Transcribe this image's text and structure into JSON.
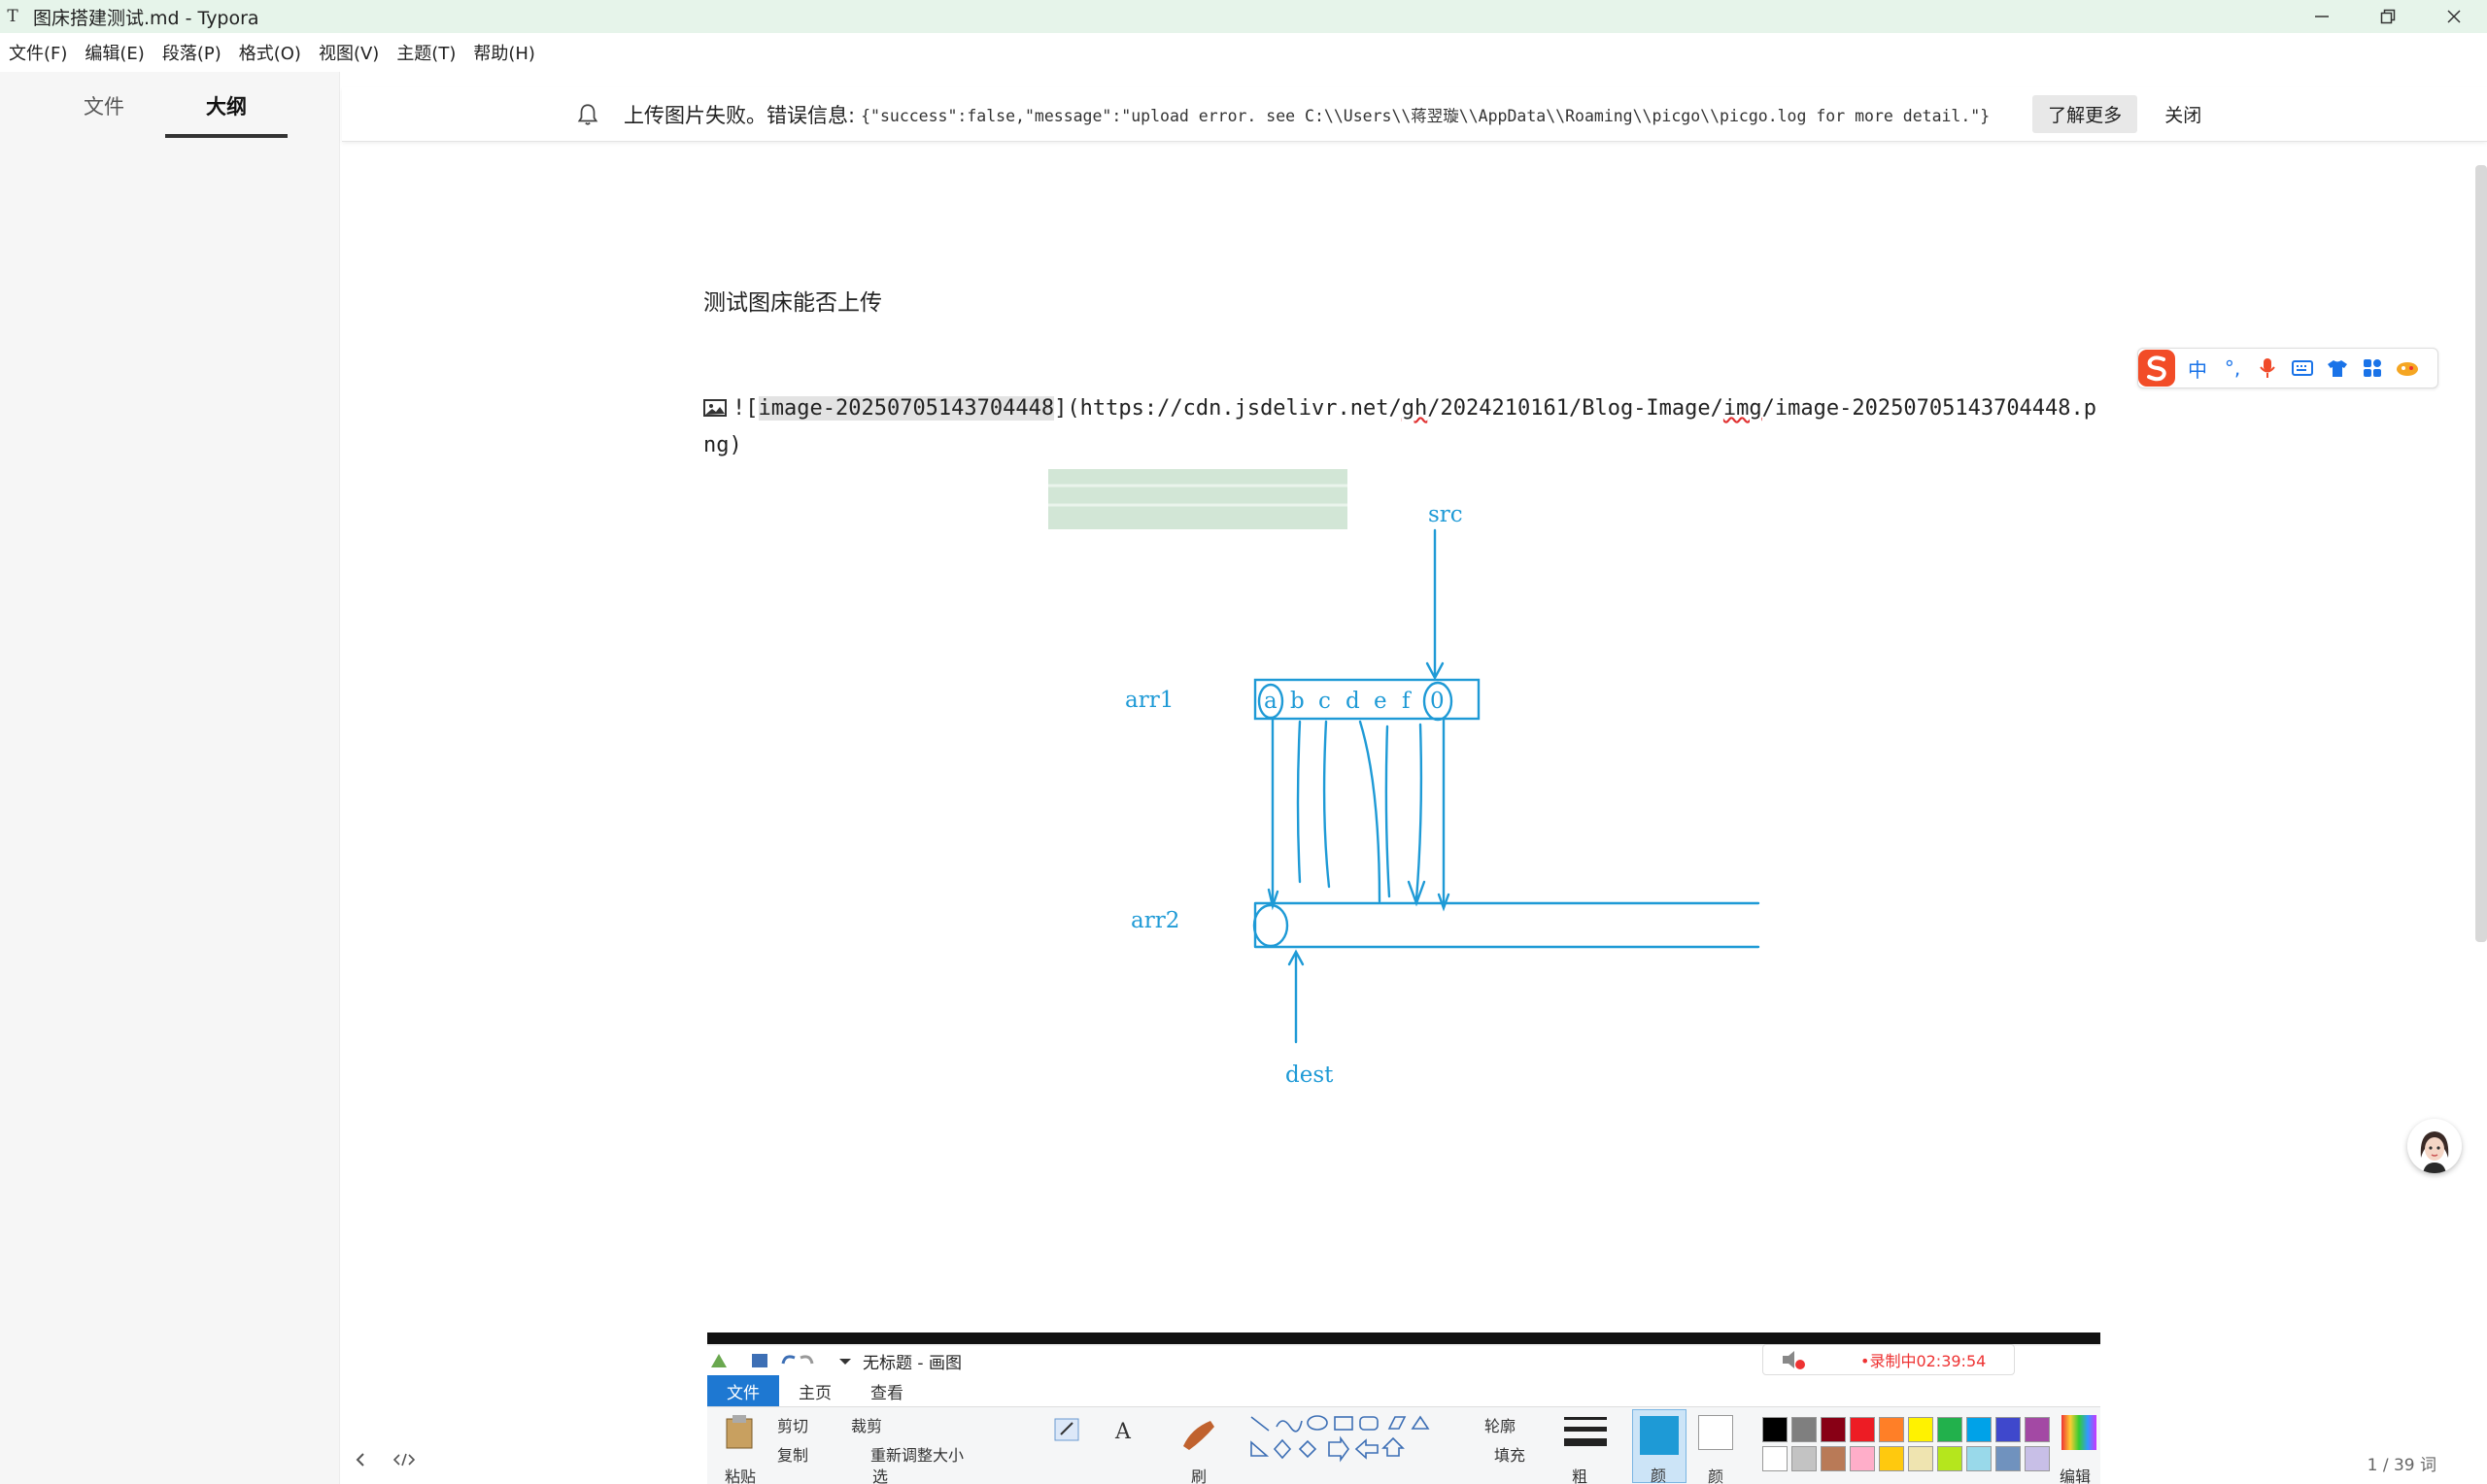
{
  "window": {
    "app_icon": "T",
    "title": "图床搭建测试.md - Typora",
    "controls": [
      "minimize-icon",
      "restore-icon",
      "close-icon"
    ]
  },
  "menu": [
    "文件(F)",
    "编辑(E)",
    "段落(P)",
    "格式(O)",
    "视图(V)",
    "主题(T)",
    "帮助(H)"
  ],
  "sidebar": {
    "tabs": [
      {
        "label": "文件",
        "active": false
      },
      {
        "label": "大纲",
        "active": true
      }
    ]
  },
  "notification": {
    "message": "上传图片失败。错误信息:",
    "detail": "{\"success\":false,\"message\":\"upload error. see C:\\\\Users\\\\蒋翌璇\\\\AppData\\\\Roaming\\\\picgo\\\\picgo.log for more detail.\"}",
    "learn_more": "了解更多",
    "close": "关闭"
  },
  "editor": {
    "paragraph": "测试图床能否上传",
    "md_prefix": "![",
    "md_alt": "image-20250705143704448",
    "md_mid": "](https://cdn.jsdelivr.net/",
    "md_gh": "gh",
    "md_mid2": "/2024210161/Blog-Image/",
    "md_img": "img",
    "md_tail": "/image-20250705143704448.png)"
  },
  "drawing": {
    "labels": {
      "src": "src",
      "arr1": "arr1",
      "arr2": "arr2",
      "dest": "dest"
    },
    "arr1_chars": [
      "a",
      "b",
      "c",
      "d",
      "e",
      "f",
      "0"
    ],
    "stroke_color": "#1e9ad6"
  },
  "ime": {
    "items": [
      "中",
      "°,",
      "mic-icon",
      "keyboard-icon",
      "shirt-icon",
      "grid-icon",
      "game-icon"
    ]
  },
  "paint_window": {
    "title": "无标题 - 画图",
    "recording": "•录制中02:39:54",
    "tabs": [
      "文件",
      "主页",
      "查看"
    ],
    "ribbon_labels": [
      "剪切",
      "复制",
      "裁剪",
      "重新调整大小",
      "轮廓",
      "填充",
      "粘贴",
      "选",
      "刷",
      "粗",
      "颜",
      "颜",
      "编辑"
    ],
    "palette": [
      "#000000",
      "#7f7f7f",
      "#880015",
      "#ed1c24",
      "#ff7f27",
      "#fff200",
      "#22b14c",
      "#00a2e8",
      "#3f48cc",
      "#a349a4",
      "#ffffff",
      "#c3c3c3",
      "#b97a57",
      "#ffaec9",
      "#ffc90e",
      "#efe4b0",
      "#b5e61d",
      "#99d9ea",
      "#7092be",
      "#c8bfe7"
    ]
  },
  "status": {
    "word_count": "1 / 39 词"
  }
}
